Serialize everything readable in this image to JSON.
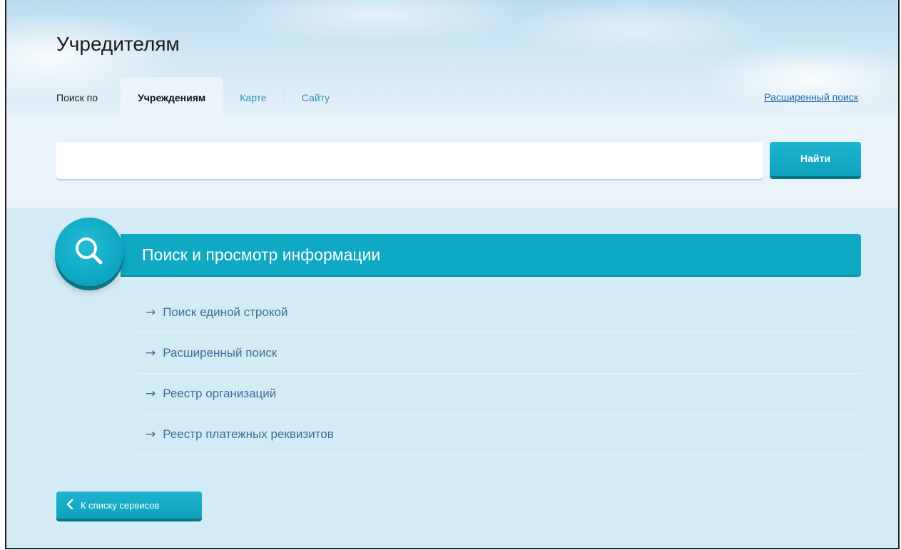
{
  "header": {
    "title": "Учредителям",
    "tabs_prefix": "Поиск по",
    "tabs": [
      {
        "label": "Учреждениям",
        "active": true
      },
      {
        "label": "Карте",
        "active": false
      },
      {
        "label": "Сайту",
        "active": false
      }
    ],
    "advanced_search_link": "Расширенный поиск"
  },
  "search": {
    "value": "",
    "button_label": "Найти"
  },
  "section": {
    "title": "Поиск и просмотр информации",
    "icon": "search-icon",
    "links": [
      {
        "label": "Поиск единой строкой"
      },
      {
        "label": "Расширенный поиск"
      },
      {
        "label": "Реестр организаций"
      },
      {
        "label": "Реестр платежных реквизитов"
      }
    ]
  },
  "footer": {
    "back_label": "К списку сервисов"
  },
  "colors": {
    "accent": "#0fa9c4",
    "link": "#3f6d9a",
    "page_bg": "#d3ebf4"
  }
}
